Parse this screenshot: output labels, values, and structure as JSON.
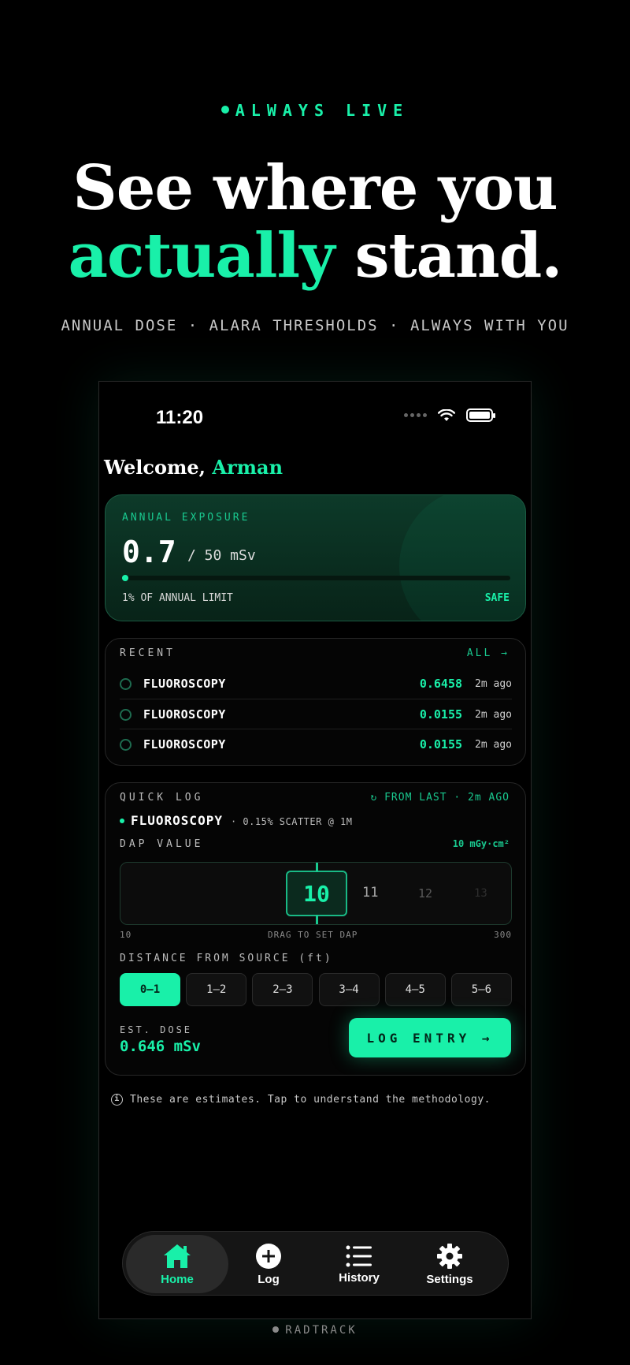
{
  "hero": {
    "eyebrow": "ALWAYS LIVE",
    "headline_line1": "See where you",
    "headline_accent": "actually",
    "headline_rest": " stand.",
    "subline": "ANNUAL DOSE · ALARA THRESHOLDS · ALWAYS WITH YOU"
  },
  "status_bar": {
    "time": "11:20"
  },
  "welcome": {
    "prefix": "Welcome, ",
    "name": "Arman"
  },
  "exposure": {
    "label": "ANNUAL EXPOSURE",
    "value": "0.7",
    "unit": "/ 50 mSv",
    "progress_fraction": 0.014,
    "percent_label": "1% OF ANNUAL LIMIT",
    "status": "SAFE"
  },
  "recent": {
    "label": "RECENT",
    "all_label": "ALL →",
    "items": [
      {
        "name": "FLUOROSCOPY",
        "value": "0.6458",
        "ago": "2m ago"
      },
      {
        "name": "FLUOROSCOPY",
        "value": "0.0155",
        "ago": "2m ago"
      },
      {
        "name": "FLUOROSCOPY",
        "value": "0.0155",
        "ago": "2m ago"
      }
    ]
  },
  "quick_log": {
    "label": "QUICK LOG",
    "from_last": "↻ FROM LAST · 2m AGO",
    "procedure": "FLUOROSCOPY",
    "procedure_meta": "· 0.15% SCATTER @ 1M",
    "dap_label": "DAP VALUE",
    "dap_unit": "10 mGy·cm²",
    "dial_values": [
      "10",
      "11",
      "12",
      "13"
    ],
    "dial_selected": "10",
    "range_min": "10",
    "range_hint": "DRAG TO SET DAP",
    "range_max": "300",
    "distance_label": "DISTANCE FROM SOURCE (ft)",
    "distances": [
      "0–1",
      "1–2",
      "2–3",
      "3–4",
      "4–5",
      "5–6"
    ],
    "distance_selected": "0–1",
    "est_label": "EST. DOSE",
    "est_value": "0.646 mSv",
    "log_button": "LOG ENTRY →"
  },
  "note": "These are estimates. Tap to understand the methodology.",
  "tabs": [
    {
      "label": "Home",
      "icon": "home-icon",
      "active": true
    },
    {
      "label": "Log",
      "icon": "plus-circle-icon",
      "active": false
    },
    {
      "label": "History",
      "icon": "list-icon",
      "active": false
    },
    {
      "label": "Settings",
      "icon": "gear-icon",
      "active": false
    }
  ],
  "footer": "RADTRACK",
  "colors": {
    "accent": "#19f0a9",
    "background": "#000000"
  }
}
